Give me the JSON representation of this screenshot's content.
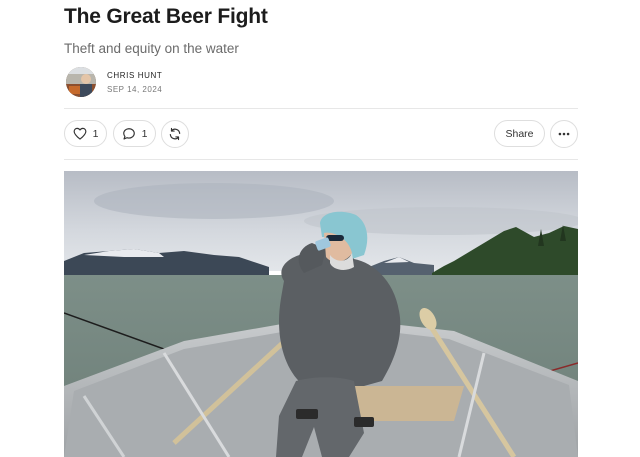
{
  "post": {
    "title": "The Great Beer Fight",
    "subtitle": "Theft and equity on the water",
    "author": "CHRIS HUNT",
    "date": "SEP 14, 2024"
  },
  "actions": {
    "like_count": "1",
    "comment_count": "1",
    "share_label": "Share"
  },
  "icons": {
    "like": "heart-icon",
    "comment": "comment-icon",
    "restack": "restack-icon",
    "more": "more-icon"
  },
  "hero_image": {
    "description_icon": "photo",
    "colors": {
      "sky": "#c9ced6",
      "water": "#7f9189",
      "boat": "#b9bcbf",
      "jacket": "#5d6064",
      "hood": "#8cc8d3"
    }
  }
}
